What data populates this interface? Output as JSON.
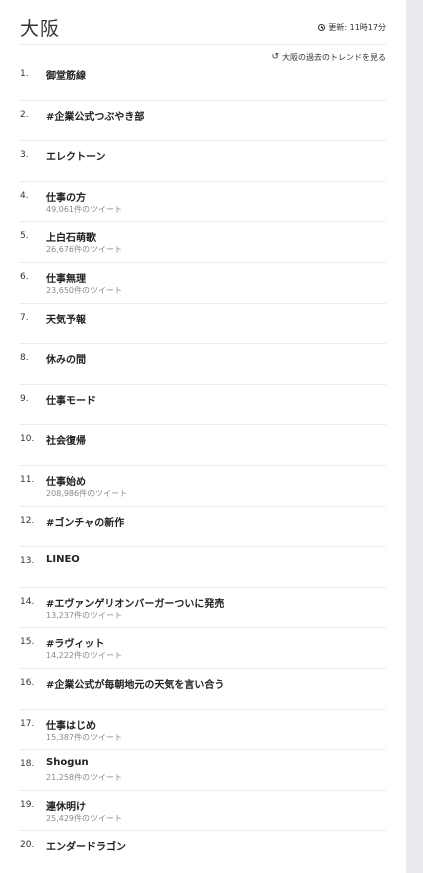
{
  "header": {
    "title": "大阪",
    "updated_label": "更新: 11時17分",
    "clock_icon": "clock-icon"
  },
  "past_trends": {
    "label": "大阪の過去のトレンドを見る",
    "icon": "history-icon"
  },
  "trends": [
    {
      "rank": "1.",
      "name": "御堂筋線",
      "count": ""
    },
    {
      "rank": "2.",
      "name": "#企業公式つぶやき部",
      "count": ""
    },
    {
      "rank": "3.",
      "name": "エレクトーン",
      "count": ""
    },
    {
      "rank": "4.",
      "name": "仕事の方",
      "count": "49,061件のツイート"
    },
    {
      "rank": "5.",
      "name": "上白石萌歌",
      "count": "26,676件のツイート"
    },
    {
      "rank": "6.",
      "name": "仕事無理",
      "count": "23,650件のツイート"
    },
    {
      "rank": "7.",
      "name": "天気予報",
      "count": ""
    },
    {
      "rank": "8.",
      "name": "休みの間",
      "count": ""
    },
    {
      "rank": "9.",
      "name": "仕事モード",
      "count": ""
    },
    {
      "rank": "10.",
      "name": "社会復帰",
      "count": ""
    },
    {
      "rank": "11.",
      "name": "仕事始め",
      "count": "208,986件のツイート"
    },
    {
      "rank": "12.",
      "name": "#ゴンチャの新作",
      "count": ""
    },
    {
      "rank": "13.",
      "name": "LINEO",
      "count": ""
    },
    {
      "rank": "14.",
      "name": "#エヴァンゲリオンバーガーついに発売",
      "count": "13,237件のツイート"
    },
    {
      "rank": "15.",
      "name": "#ラヴィット",
      "count": "14,222件のツイート"
    },
    {
      "rank": "16.",
      "name": "#企業公式が毎朝地元の天気を言い合う",
      "count": ""
    },
    {
      "rank": "17.",
      "name": "仕事はじめ",
      "count": "15,387件のツイート"
    },
    {
      "rank": "18.",
      "name": "Shogun",
      "count": "21,258件のツイート"
    },
    {
      "rank": "19.",
      "name": "連休明け",
      "count": "25,429件のツイート"
    },
    {
      "rank": "20.",
      "name": "エンダードラゴン",
      "count": ""
    }
  ]
}
